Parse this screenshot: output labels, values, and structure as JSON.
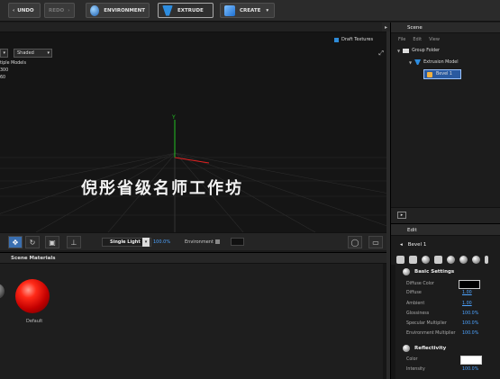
{
  "toolbar": {
    "undo_label": "UNDO",
    "redo_label": "REDO",
    "environment_label": "ENVIRONMENT",
    "extrude_label": "EXTRUDE",
    "create_label": "CREATE"
  },
  "viewport": {
    "draft_textures_label": "Draft Textures",
    "shading_mode": "Shaded",
    "stats": [
      "tiple Models",
      "300",
      "60"
    ],
    "watermark": "倪彤省级名师工作坊"
  },
  "viewport_bar": {
    "light_select": "Single Light",
    "light_value": "100.0%",
    "environment_label": "Environment"
  },
  "materials": {
    "tab_label": "Scene Materials",
    "items": [
      {
        "label": "Default"
      }
    ]
  },
  "scene": {
    "tab_label": "Scene",
    "menu": [
      "File",
      "Edit",
      "View"
    ],
    "tree": [
      {
        "label": "Group Folder"
      },
      {
        "label": "Extrusion Model"
      },
      {
        "label": "Bevel 1"
      }
    ]
  },
  "edit": {
    "tab_label": "Edit",
    "title": "Bevel 1",
    "sections": [
      {
        "label": "Basic Settings",
        "props": [
          {
            "label": "Diffuse Color",
            "value": ""
          },
          {
            "label": "Diffuse",
            "value": "1.00"
          },
          {
            "label": "Ambient",
            "value": "1.00"
          },
          {
            "label": "Glossiness",
            "value": "100.0%"
          },
          {
            "label": "Specular Multiplier",
            "value": "100.0%"
          },
          {
            "label": "Environment Multiplier",
            "value": "100.0%"
          }
        ]
      },
      {
        "label": "Reflectivity",
        "props": [
          {
            "label": "Color",
            "value": ""
          },
          {
            "label": "Intensity",
            "value": "100.0%"
          }
        ]
      }
    ]
  },
  "colors": {
    "accent_blue": "#4da3ff",
    "selection_blue": "#2a5aa0",
    "material_red": "#d40000"
  }
}
